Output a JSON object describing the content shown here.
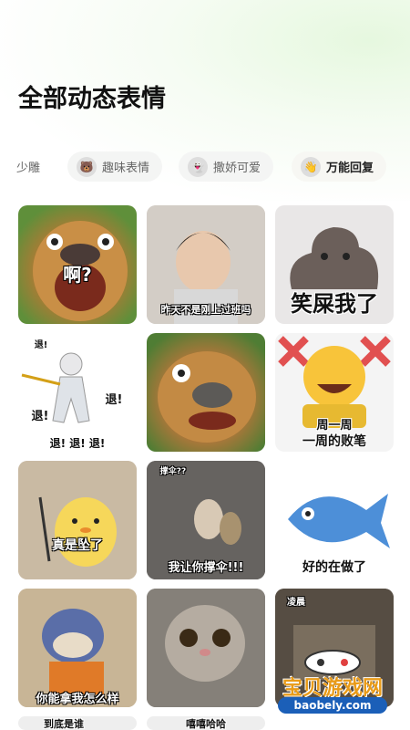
{
  "page": {
    "title": "全部动态表情"
  },
  "tabs": [
    {
      "label": "少雕",
      "icon": ""
    },
    {
      "label": "趣味表情",
      "icon": "🐻"
    },
    {
      "label": "撒娇可爱",
      "icon": "👻"
    },
    {
      "label": "万能回复",
      "icon": "👋"
    }
  ],
  "stickers": [
    {
      "caption": "啊?"
    },
    {
      "caption": "昨天不是刚上过班吗"
    },
    {
      "caption": "笑屎我了"
    },
    {
      "caption": "退!",
      "sub": "退!",
      "sub2": "退!",
      "bottom": "退! 退! 退!"
    },
    {
      "caption": ""
    },
    {
      "caption": "周一周",
      "caption2": "一周的败笔"
    },
    {
      "caption": "真是坠了"
    },
    {
      "caption": "我让你撑伞!!!",
      "top": "撑伞??"
    },
    {
      "caption": "好的在做了"
    },
    {
      "caption": "你能拿我怎么样"
    },
    {
      "caption": ""
    },
    {
      "caption": "",
      "top": "凌晨"
    }
  ],
  "bottom_row": [
    {
      "caption": "到底是谁"
    },
    {
      "caption": "嘻嘻哈哈"
    }
  ],
  "watermark": {
    "text": "宝贝游戏网",
    "url": "baobely.com"
  }
}
